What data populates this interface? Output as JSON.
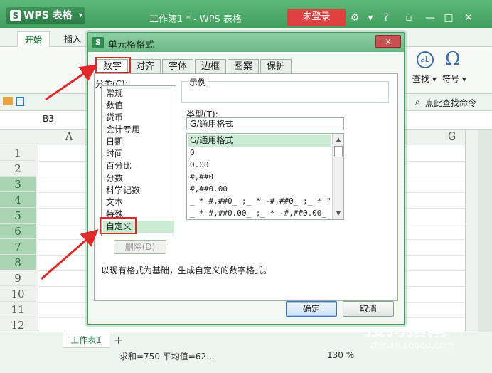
{
  "app": {
    "menu_label": "WPS 表格",
    "doc_title": "工作簿1 * - WPS 表格",
    "login_label": "未登录"
  },
  "ribbon": {
    "tabs": [
      "开始",
      "插入"
    ],
    "find_label": "查找 ▾",
    "symbol_label": "符号 ▾",
    "search_cmd": "点此查找命令"
  },
  "formula_bar": {
    "cell_ref": "B3"
  },
  "grid": {
    "columns": [
      "A",
      "G"
    ],
    "rows": [
      "1",
      "2",
      "3",
      "4",
      "5",
      "6",
      "7",
      "8",
      "9",
      "10",
      "11",
      "12"
    ]
  },
  "sheet": {
    "tab_label": "工作表1",
    "add_label": "+"
  },
  "status": {
    "summary": "求和=750 平均值=62...",
    "zoom": "130 %"
  },
  "dialog": {
    "title": "单元格格式",
    "close_label": "x",
    "tabs": [
      "数字",
      "对齐",
      "字体",
      "边框",
      "图案",
      "保护"
    ],
    "category_label": "分类(C):",
    "categories": [
      "常规",
      "数值",
      "货币",
      "会计专用",
      "日期",
      "时间",
      "百分比",
      "分数",
      "科学记数",
      "文本",
      "特殊",
      "自定义"
    ],
    "sample_label": "示例",
    "type_label": "类型(T):",
    "type_value": "G/通用格式",
    "formats": [
      "G/通用格式",
      "0",
      "0.00",
      "#,##0",
      "#,##0.00",
      "_ * #,##0_ ;_ * -#,##0_ ;_ * \"-\"…",
      "_ * #,##0.00_ ;_ * -#,##0.00_ ;_…"
    ],
    "delete_label": "删除(D)",
    "description": "以现有格式为基础，生成自定义的数字格式。",
    "ok_label": "确定",
    "cancel_label": "取消"
  },
  "watermark": {
    "text": "搜狗指南",
    "url": "zhinan.sogou.com"
  },
  "colors": {
    "accent": "#4a9a63",
    "annotation": "#e02828"
  }
}
